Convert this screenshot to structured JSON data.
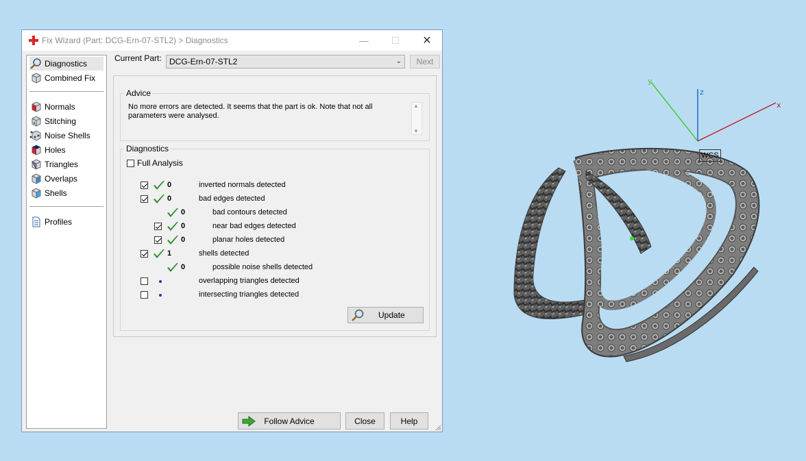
{
  "window": {
    "title": "Fix Wizard (Part: DCG-Ern-07-STL2) > Diagnostics",
    "controls": [
      "minimize-icon",
      "maximize-icon",
      "close-icon"
    ]
  },
  "sidebar": {
    "items": [
      {
        "label": "Diagnostics",
        "icon": "magnifier-icon",
        "selected": true
      },
      {
        "label": "Combined Fix",
        "icon": "cube-icon"
      },
      {
        "label": "Normals",
        "icon": "cube-red-face-icon"
      },
      {
        "label": "Stitching",
        "icon": "cube-stitch-icon"
      },
      {
        "label": "Noise Shells",
        "icon": "cube-dots-icon"
      },
      {
        "label": "Holes",
        "icon": "cube-hole-icon"
      },
      {
        "label": "Triangles",
        "icon": "cube-triangle-icon"
      },
      {
        "label": "Overlaps",
        "icon": "cube-overlap-icon"
      },
      {
        "label": "Shells",
        "icon": "cube-shell-icon"
      },
      {
        "label": "Profiles",
        "icon": "document-icon"
      }
    ]
  },
  "current_part": {
    "label": "Current Part:",
    "value": "DCG-Ern-07-STL2",
    "next_label": "Next"
  },
  "advice": {
    "title": "Advice",
    "text": "No more errors are detected. It seems that the part is ok. Note that not all parameters were analysed."
  },
  "diagnostics": {
    "title": "Diagnostics",
    "full_analysis_label": "Full Analysis",
    "full_analysis_checked": false,
    "rows": [
      {
        "checkbox": true,
        "checked": true,
        "status": "ok",
        "count": "0",
        "label": "inverted normals detected",
        "indent": 0
      },
      {
        "checkbox": true,
        "checked": true,
        "status": "ok",
        "count": "0",
        "label": "bad edges detected",
        "indent": 0
      },
      {
        "checkbox": false,
        "checked": false,
        "status": "ok",
        "count": "0",
        "label": "bad contours detected",
        "indent": 1
      },
      {
        "checkbox": true,
        "checked": true,
        "status": "ok",
        "count": "0",
        "label": "near bad edges detected",
        "indent": 1
      },
      {
        "checkbox": true,
        "checked": true,
        "status": "ok",
        "count": "0",
        "label": "planar holes detected",
        "indent": 1
      },
      {
        "checkbox": true,
        "checked": true,
        "status": "ok",
        "count": "1",
        "label": "shells detected",
        "indent": 0
      },
      {
        "checkbox": false,
        "checked": false,
        "status": "ok",
        "count": "0",
        "label": "possible noise shells detected",
        "indent": 1
      },
      {
        "checkbox": true,
        "checked": false,
        "status": "not-analysed",
        "count": "",
        "label": "overlapping triangles detected",
        "indent": 0
      },
      {
        "checkbox": true,
        "checked": false,
        "status": "not-analysed",
        "count": "",
        "label": "intersecting triangles detected",
        "indent": 0
      }
    ],
    "update_label": "Update"
  },
  "footer": {
    "follow_advice_label": "Follow Advice",
    "close_label": "Close",
    "help_label": "Help"
  },
  "viewport": {
    "axes": {
      "x": "x",
      "y": "y",
      "z": "z"
    },
    "wcs_label": "WCS",
    "colors": {
      "x_axis": "#c0202a",
      "y_axis": "#44cc33",
      "z_axis": "#2266cc",
      "background": "#b9dcf3"
    }
  }
}
